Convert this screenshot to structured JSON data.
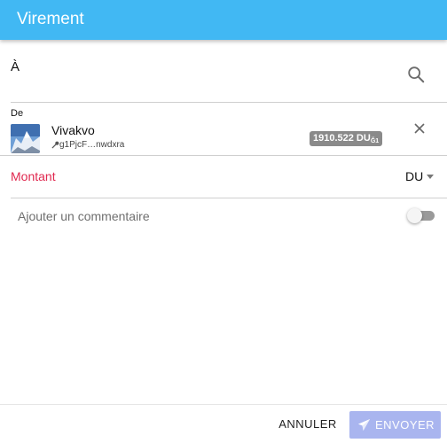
{
  "header": {
    "title": "Virement",
    "color": "#41b8f3"
  },
  "to": {
    "label": "À",
    "search_icon": "search-icon"
  },
  "from": {
    "label": "De",
    "account_name": "Vivakvo",
    "account_key": "g1PjcF…nwdxra",
    "balance_amount": "1910.522 DU",
    "balance_sub": "Ğ1",
    "key_icon": "key-icon",
    "close_icon": "close-icon"
  },
  "amount": {
    "label": "Montant",
    "unit": "DU",
    "label_color": "#e0284f"
  },
  "comment": {
    "label": "Ajouter un commentaire",
    "toggle_on": false
  },
  "footer": {
    "cancel_label": "ANNULER",
    "send_label": "ENVOYER",
    "send_color": "#a9b5ef"
  }
}
